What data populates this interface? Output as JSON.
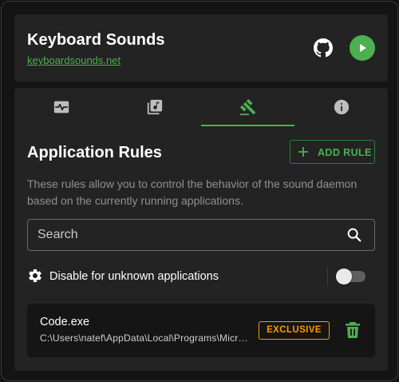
{
  "header": {
    "title": "Keyboard Sounds",
    "link_text": "keyboardsounds.net",
    "github_icon": "github-icon",
    "play_icon": "play-icon"
  },
  "tabs": [
    {
      "icon": "activity-icon",
      "active": false
    },
    {
      "icon": "music-library-icon",
      "active": false
    },
    {
      "icon": "gavel-icon",
      "active": true
    },
    {
      "icon": "info-icon",
      "active": false
    }
  ],
  "rules": {
    "title": "Application Rules",
    "add_label": "ADD RULE",
    "description": "These rules allow you to control the behavior of the sound daemon based on the currently running applications.",
    "search_placeholder": "Search",
    "search_value": "",
    "disable_unknown_label": "Disable for unknown applications",
    "disable_unknown_enabled": false,
    "items": [
      {
        "name": "Code.exe",
        "path": "C:\\Users\\natef\\AppData\\Local\\Programs\\Microsoft VS Code\\Code.exe",
        "badge": "EXCLUSIVE"
      }
    ]
  },
  "colors": {
    "accent": "#4caf50",
    "badge": "#ff9800",
    "card": "#232323",
    "background": "#141414"
  }
}
